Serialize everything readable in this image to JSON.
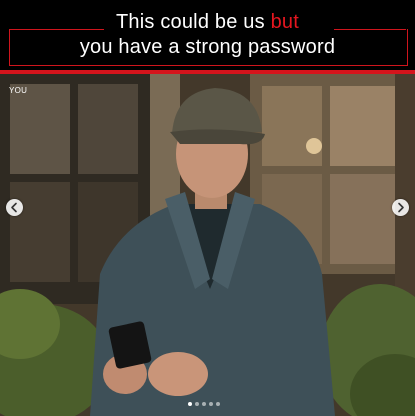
{
  "post": {
    "caption_line1_before": "This could be us ",
    "caption_line1_highlight": "but",
    "caption_line2": "you have a strong password",
    "tag_label": "YOU",
    "accent_color": "#d4141c",
    "highlight_color": "#e4161f"
  },
  "carousel": {
    "prev_icon": "chevron-left-icon",
    "next_icon": "chevron-right-icon",
    "slide_count": 5,
    "active_slide": 1
  }
}
